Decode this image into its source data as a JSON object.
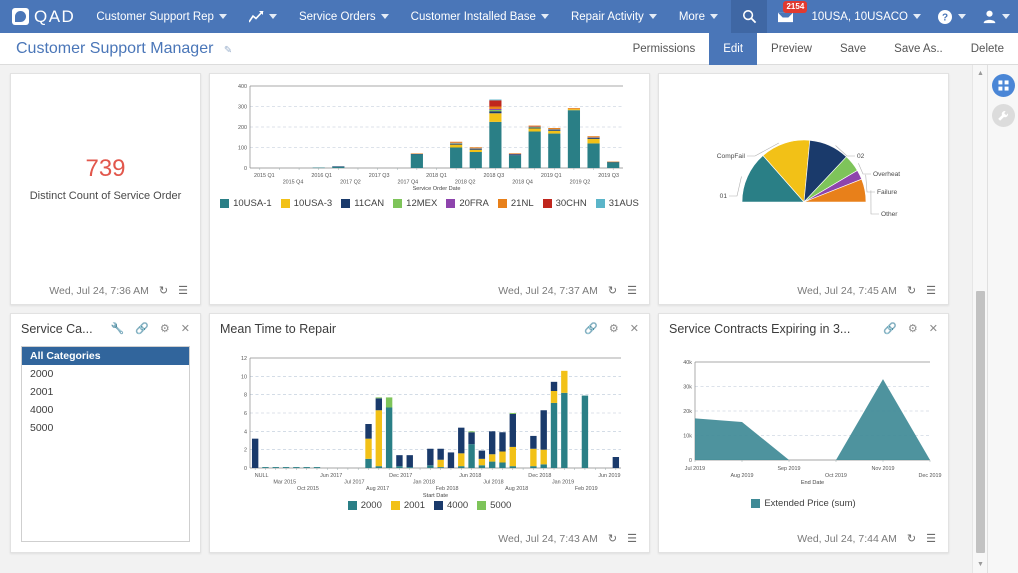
{
  "topnav": {
    "brand": "QAD",
    "items": [
      {
        "label": "Customer Support Rep",
        "caret": true
      },
      {
        "label": "",
        "icon": "chart-icon",
        "caret": true
      },
      {
        "label": "Service Orders",
        "caret": true
      },
      {
        "label": "Customer Installed Base",
        "caret": true
      },
      {
        "label": "Repair Activity",
        "caret": true
      },
      {
        "label": "More",
        "caret": true
      }
    ],
    "search_icon": "search-icon",
    "inbox_icon": "inbox-icon",
    "inbox_badge": "2154",
    "company": "10USA, 10USACO",
    "help_icon": "help-icon",
    "user_icon": "user-icon"
  },
  "titlebar": {
    "title": "Customer Support Manager",
    "edit_pencil": "pencil-icon",
    "actions": [
      {
        "label": "Permissions",
        "active": false
      },
      {
        "label": "Edit",
        "active": true
      },
      {
        "label": "Preview",
        "active": false
      },
      {
        "label": "Save",
        "active": false
      },
      {
        "label": "Save As..",
        "active": false
      },
      {
        "label": "Delete",
        "active": false
      }
    ]
  },
  "rail": {
    "widgets_label": "☷",
    "settings_label": "🔧"
  },
  "cards": {
    "kpi": {
      "value": "739",
      "label": "Distinct Count of Service Order",
      "timestamp": "Wed, Jul 24, 7:36 AM",
      "refresh_icon": "refresh-icon",
      "menu_icon": "list-menu-icon"
    },
    "bar": {
      "timestamp": "Wed, Jul 24, 7:37 AM",
      "refresh_icon": "refresh-icon",
      "menu_icon": "list-menu-icon"
    },
    "pie": {
      "timestamp": "Wed, Jul 24, 7:45 AM",
      "refresh_icon": "refresh-icon",
      "menu_icon": "list-menu-icon"
    },
    "selector": {
      "title": "Service Ca...",
      "icons": [
        "wrench-icon",
        "link-icon",
        "gear-icon",
        "close-icon"
      ],
      "options": [
        "All Categories",
        "2000",
        "2001",
        "4000",
        "5000"
      ],
      "selected": "All Categories"
    },
    "mttr": {
      "title": "Mean Time to Repair",
      "icons": [
        "link-icon",
        "gear-icon",
        "close-icon"
      ],
      "timestamp": "Wed, Jul 24, 7:43 AM",
      "refresh_icon": "refresh-icon",
      "menu_icon": "list-menu-icon"
    },
    "contracts": {
      "title": "Service Contracts Expiring in 3...",
      "icons": [
        "link-icon",
        "gear-icon",
        "close-icon"
      ],
      "timestamp": "Wed, Jul 24, 7:44 AM",
      "refresh_icon": "refresh-icon",
      "menu_icon": "list-menu-icon"
    }
  },
  "chart_data": [
    {
      "id": "service-order-bar",
      "type": "bar",
      "stacked": true,
      "title": "",
      "xlabel": "Service Order Date",
      "ylabel": "",
      "ylim": [
        0,
        400
      ],
      "yticks": [
        0,
        100,
        200,
        300,
        400
      ],
      "grid": true,
      "legend_position": "bottom",
      "categories": [
        "2015 Q1",
        "2015 Q2",
        "2015 Q3",
        "2015 Q4",
        "2016 Q1",
        "2016 Q2",
        "2016 Q3",
        "2016 Q4",
        "2017 Q1",
        "2017 Q2",
        "2017 Q3",
        "2017 Q4",
        "2018 Q1",
        "2018 Q2",
        "2018 Q3",
        "2018 Q4",
        "2019 Q1",
        "2019 Q2",
        "2019 Q3"
      ],
      "tick_labels": [
        "2015 Q1",
        "2015 Q4",
        "2016 Q1",
        "2017 Q2",
        "2017 Q3",
        "2017 Q4",
        "2018 Q1",
        "2018 Q2",
        "2018 Q3",
        "2018 Q4",
        "2019 Q1",
        "2019 Q2",
        "2019 Q3"
      ],
      "series": [
        {
          "name": "10USA-1",
          "color": "#2a7f86",
          "values": [
            0,
            0,
            0,
            2,
            7,
            0,
            0,
            0,
            67,
            0,
            100,
            78,
            225,
            62,
            178,
            168,
            282,
            120,
            28
          ]
        },
        {
          "name": "10USA-3",
          "color": "#f2c117",
          "values": [
            0,
            0,
            0,
            0,
            0,
            0,
            0,
            0,
            0,
            0,
            14,
            11,
            42,
            0,
            15,
            13,
            5,
            22,
            0
          ]
        },
        {
          "name": "11CAN",
          "color": "#1a3a6b",
          "values": [
            0,
            0,
            0,
            0,
            1,
            0,
            0,
            0,
            2,
            0,
            4,
            4,
            10,
            4,
            4,
            4,
            0,
            5,
            2
          ]
        },
        {
          "name": "12MEX",
          "color": "#7ec45a",
          "values": [
            0,
            0,
            0,
            0,
            0,
            0,
            0,
            0,
            0,
            0,
            3,
            2,
            6,
            2,
            3,
            3,
            0,
            2,
            0
          ]
        },
        {
          "name": "20FRA",
          "color": "#8e44ad",
          "values": [
            0,
            0,
            0,
            0,
            0,
            0,
            0,
            0,
            0,
            0,
            2,
            2,
            5,
            1,
            2,
            2,
            0,
            1,
            0
          ]
        },
        {
          "name": "21NL",
          "color": "#e8801a",
          "values": [
            0,
            0,
            0,
            0,
            0,
            0,
            0,
            0,
            2,
            0,
            5,
            4,
            12,
            3,
            5,
            5,
            5,
            5,
            1
          ]
        },
        {
          "name": "30CHN",
          "color": "#c0261d",
          "values": [
            0,
            0,
            0,
            0,
            0,
            0,
            0,
            0,
            0,
            0,
            0,
            0,
            30,
            0,
            0,
            0,
            0,
            0,
            0
          ]
        },
        {
          "name": "31AUS",
          "color": "#5bb5c9",
          "values": [
            0,
            0,
            0,
            0,
            0,
            0,
            0,
            0,
            0,
            0,
            0,
            0,
            4,
            0,
            0,
            0,
            0,
            0,
            0
          ]
        }
      ]
    },
    {
      "id": "failure-reason-pie",
      "type": "pie",
      "shape": "semicircle",
      "title": "",
      "labels": [
        "01",
        "CompFail",
        "02",
        "Overheat",
        "Failure",
        "Other"
      ],
      "values": [
        27,
        26,
        21,
        9,
        5,
        12
      ],
      "colors": [
        "#2a7f86",
        "#f2c117",
        "#1a3a6b",
        "#7ec45a",
        "#8e44ad",
        "#e8801a"
      ],
      "legend_position": "callout"
    },
    {
      "id": "mean-time-to-repair",
      "type": "bar",
      "stacked": true,
      "title": "Mean Time to Repair",
      "xlabel": "Start Date",
      "ylabel": "",
      "ylim": [
        0,
        12
      ],
      "yticks": [
        0,
        2,
        4,
        6,
        8,
        10,
        12
      ],
      "grid": true,
      "legend_position": "bottom",
      "categories": [
        "NULL",
        "Feb 2015",
        "Mar 2015",
        "Apr 2015",
        "Jun 2015",
        "Oct 2015",
        "Dec 2015",
        "Feb 2016",
        "Apr 2016",
        "Jun 2016",
        "Mar 2017",
        "Jun 2017",
        "Jul 2017",
        "Aug 2017",
        "Sep 2017",
        "Oct 2017",
        "Nov 2017",
        "Dec 2017",
        "Jan 2018",
        "Feb 2018",
        "Mar 2018",
        "Apr 2018",
        "May 2018",
        "Jun 2018",
        "Jul 2018",
        "Aug 2018",
        "Sep 2018",
        "Oct 2018",
        "Nov 2018",
        "Dec 2018",
        "Jan 2019",
        "Feb 2019",
        "Mar 2019",
        "Apr 2019",
        "May 2019",
        "Jun 2019"
      ],
      "tick_labels": [
        "NULL",
        "Mar 2015",
        "Oct 2015",
        "Jun 2017",
        "Jul 2017",
        "Aug 2017",
        "Dec 2017",
        "Jan 2018",
        "Feb 2018",
        "Jun 2018",
        "Jul 2018",
        "Aug 2018",
        "Dec 2018",
        "Jan 2019",
        "Feb 2019",
        "Jun 2019"
      ],
      "series": [
        {
          "name": "2000",
          "color": "#2a7f86",
          "values": [
            0,
            0.1,
            0.1,
            0.1,
            0.1,
            0.1,
            0.1,
            0,
            0,
            0,
            0,
            1.0,
            0.2,
            6.6,
            0.2,
            0.1,
            0,
            0.3,
            0.1,
            0,
            0.2,
            2.6,
            0.3,
            0.7,
            0.6,
            0.2,
            0,
            0.2,
            0.4,
            7.1,
            8.2,
            0,
            7.9,
            0,
            0,
            0
          ]
        },
        {
          "name": "2001",
          "color": "#f2c117",
          "values": [
            0,
            0,
            0,
            0,
            0,
            0,
            0,
            0,
            0,
            0,
            0,
            2.2,
            6.1,
            0,
            0,
            0,
            0,
            0,
            0.8,
            0,
            1.4,
            0,
            0.7,
            0.8,
            1.2,
            2.1,
            0,
            1.9,
            1.6,
            1.3,
            2.4,
            0,
            0,
            0,
            0,
            0
          ]
        },
        {
          "name": "4000",
          "color": "#1a3a6b",
          "values": [
            3.2,
            0,
            0,
            0,
            0,
            0,
            0,
            0,
            0,
            0,
            0,
            1.6,
            1.3,
            0,
            1.2,
            1.3,
            0,
            1.8,
            1.2,
            1.7,
            2.8,
            1.3,
            0.9,
            2.5,
            2.1,
            3.6,
            0,
            1.4,
            4.3,
            1.0,
            0,
            0,
            0,
            0,
            0,
            1.2
          ]
        },
        {
          "name": "5000",
          "color": "#7ec45a",
          "values": [
            0,
            0,
            0,
            0,
            0,
            0,
            0,
            0,
            0,
            0,
            0,
            0,
            0.1,
            1.1,
            0,
            0,
            0,
            0,
            0,
            0,
            0,
            0.1,
            0,
            0,
            0,
            0.1,
            0,
            0,
            0,
            0,
            0,
            0,
            0,
            0,
            0,
            0
          ]
        }
      ]
    },
    {
      "id": "service-contracts-expiring",
      "type": "area",
      "title": "Service Contracts Expiring in 3...",
      "xlabel": "End Date",
      "ylabel": "",
      "ylim": [
        0,
        40000
      ],
      "yticks": [
        0,
        10000,
        20000,
        30000,
        40000
      ],
      "ytick_labels": [
        "0",
        "10k",
        "20k",
        "30k",
        "40k"
      ],
      "grid": true,
      "legend_position": "bottom",
      "categories": [
        "Jul 2019",
        "Aug 2019",
        "Sep 2019",
        "Oct 2019",
        "Nov 2019",
        "Dec 2019"
      ],
      "tick_labels": [
        "Jul 2019",
        "Aug 2019",
        "Sep 2019",
        "Oct 2019",
        "Nov 2019",
        "Dec 2019"
      ],
      "series": [
        {
          "name": "Extended Price (sum)",
          "color": "#3f8a96",
          "values": [
            17000,
            15500,
            0,
            0,
            33000,
            0
          ]
        }
      ]
    }
  ]
}
